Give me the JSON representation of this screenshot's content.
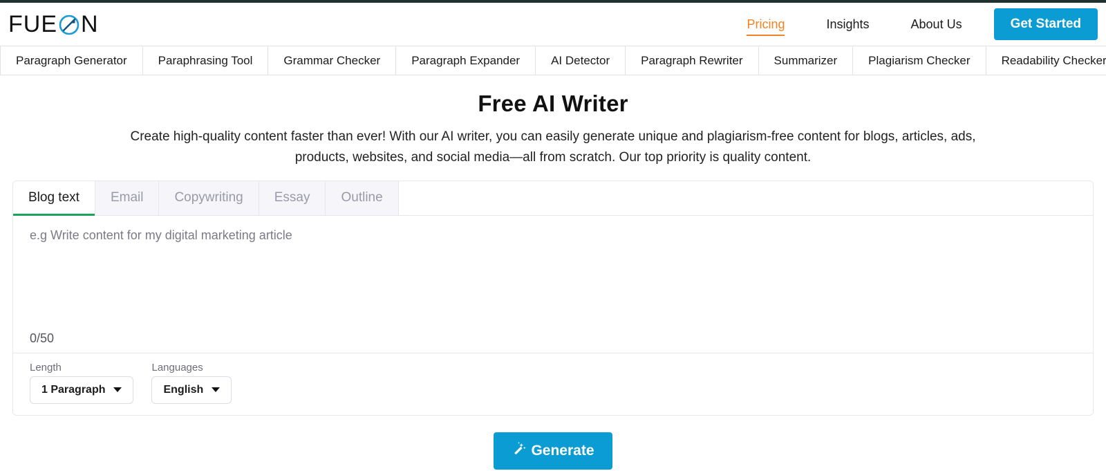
{
  "brand": {
    "name_part1": "FUE",
    "name_part2": "N",
    "logo_icon": "circle-slash-icon",
    "accent_blue": "#0b9cd3",
    "accent_orange": "#f58220",
    "accent_green": "#18a558"
  },
  "header": {
    "nav_links": [
      {
        "label": "Pricing",
        "active": true
      },
      {
        "label": "Insights",
        "active": false
      },
      {
        "label": "About Us",
        "active": false
      }
    ],
    "cta_label": "Get Started"
  },
  "toolnav": {
    "items": [
      {
        "label": "Paragraph Generator"
      },
      {
        "label": "Paraphrasing Tool"
      },
      {
        "label": "Grammar Checker"
      },
      {
        "label": "Paragraph Expander"
      },
      {
        "label": "AI Detector"
      },
      {
        "label": "Paragraph Rewriter"
      },
      {
        "label": "Summarizer"
      },
      {
        "label": "Plagiarism Checker"
      },
      {
        "label": "Readability Checker"
      }
    ]
  },
  "hero": {
    "title": "Free AI Writer",
    "description": "Create high-quality content faster than ever! With our AI writer, you can easily generate unique and plagiarism-free content for blogs, articles, ads, products, websites, and social media—all from scratch. Our top priority is quality content."
  },
  "card": {
    "tabs": [
      {
        "label": "Blog text",
        "active": true
      },
      {
        "label": "Email",
        "active": false
      },
      {
        "label": "Copywriting",
        "active": false
      },
      {
        "label": "Essay",
        "active": false
      },
      {
        "label": "Outline",
        "active": false
      }
    ],
    "editor": {
      "value": "",
      "placeholder": "e.g Write content for my digital marketing article",
      "counter": "0/50"
    },
    "controls": {
      "length": {
        "label": "Length",
        "value": "1 Paragraph"
      },
      "languages": {
        "label": "Languages",
        "value": "English"
      }
    }
  },
  "generate": {
    "label": "Generate",
    "icon": "magic-wand-icon"
  }
}
